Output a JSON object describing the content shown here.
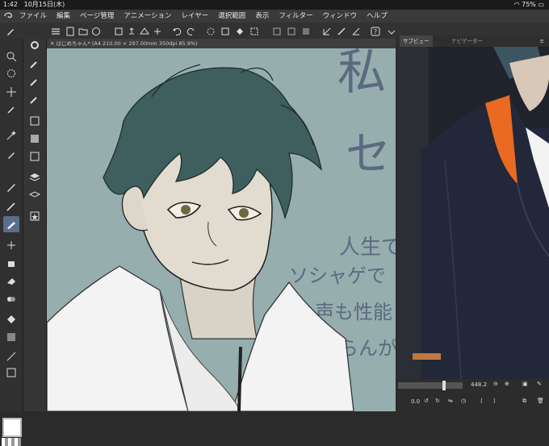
{
  "status_bar": {
    "time": "1:42",
    "date": "10月15日(木)",
    "battery": "75%"
  },
  "menu": {
    "items": [
      "ファイル",
      "編集",
      "ページ管理",
      "アニメーション",
      "レイヤー",
      "選択範囲",
      "表示",
      "フィルター",
      "ウィンドウ",
      "ヘルプ"
    ]
  },
  "document_tab": {
    "title": "はじめちゃん* (A4 210.00 × 297.00mm 350dpi 85.9%)"
  },
  "right_panel": {
    "tab_subview": "サブビュー",
    "tab_navigator": "ナビゲーター",
    "zoom_value": "448.2",
    "rotation_value": "0.0"
  },
  "colors": {
    "canvas_bg": "#96aeae",
    "accent": "#5a6e8c",
    "hair": "#3f5f5e"
  },
  "handwriting": {
    "line1": "私",
    "line2": "セ",
    "line3": "人生で",
    "line4": "ソシャゲで",
    "line5": "声も性能",
    "line6": "命らんが"
  }
}
